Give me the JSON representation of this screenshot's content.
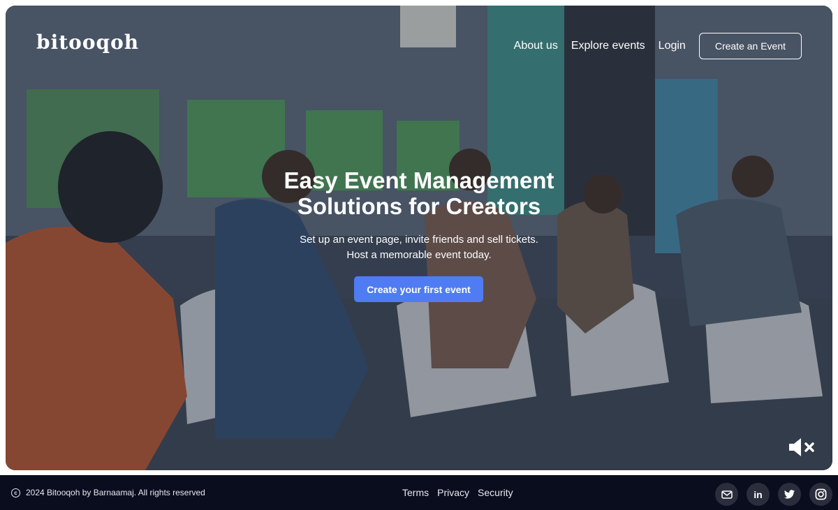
{
  "brand": {
    "logo_text": "bitooqoh"
  },
  "nav": {
    "about": "About us",
    "explore": "Explore events",
    "login": "Login",
    "create": "Create an Event"
  },
  "hero": {
    "title_line1": "Easy Event Management",
    "title_line2": "Solutions for Creators",
    "subtitle_line1": "Set up an event page, invite friends and sell tickets.",
    "subtitle_line2": "Host a memorable event today.",
    "cta": "Create your first event",
    "cta_color": "#4f7cf3"
  },
  "media": {
    "audio_state": "muted",
    "icon": "volume-mute-icon"
  },
  "footer": {
    "copyright": "2024 Bitooqoh by Barnaamaj. All rights reserved",
    "links": [
      "Terms",
      "Privacy",
      "Security"
    ],
    "socials": [
      "mail-icon",
      "linkedin-icon",
      "twitter-icon",
      "instagram-icon"
    ],
    "linkedin_text": "in",
    "background": "#0a0d1e"
  }
}
